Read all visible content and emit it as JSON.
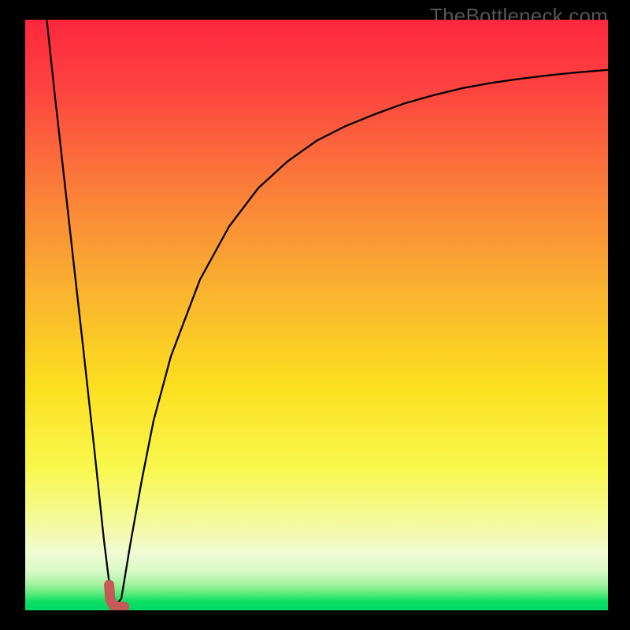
{
  "source_watermark": "TheBottleneck.com",
  "chart_data": {
    "type": "line",
    "title": "",
    "xlabel": "",
    "ylabel": "",
    "xlim": [
      0,
      100
    ],
    "ylim": [
      0,
      100
    ],
    "grid": false,
    "legend": false,
    "series": [
      {
        "name": "bottleneck-curve",
        "color": "#000000",
        "stroke_width": 2.3,
        "x": [
          3.7,
          5,
          7.5,
          10,
          12,
          13.5,
          14.5,
          15.3,
          16.5,
          18,
          20,
          22,
          25,
          30,
          35,
          40,
          45,
          50,
          55,
          60,
          65,
          70,
          75,
          80,
          85,
          90,
          95,
          100
        ],
        "values": [
          100,
          88,
          66,
          44,
          26,
          12,
          4,
          0.5,
          2,
          11,
          22,
          32,
          43,
          56,
          65,
          71.5,
          76,
          79.5,
          82,
          84,
          85.8,
          87.2,
          88.4,
          89.3,
          90,
          90.6,
          91.1,
          91.5
        ]
      },
      {
        "name": "highlight-marker",
        "color": "#c65a57",
        "stroke_width": 13,
        "linecap": "round",
        "x": [
          14.4,
          14.6,
          15.3,
          16.2,
          17.0
        ],
        "values": [
          4.3,
          1.8,
          0.6,
          0.6,
          0.6
        ]
      }
    ],
    "background_gradient": {
      "stops": [
        {
          "offset": 0.0,
          "color": "#fd273e"
        },
        {
          "offset": 0.12,
          "color": "#fd4440"
        },
        {
          "offset": 0.28,
          "color": "#fb7c3a"
        },
        {
          "offset": 0.45,
          "color": "#fab030"
        },
        {
          "offset": 0.62,
          "color": "#fcdf1f"
        },
        {
          "offset": 0.76,
          "color": "#f8f84e"
        },
        {
          "offset": 0.85,
          "color": "#f4fa9c"
        },
        {
          "offset": 0.905,
          "color": "#f0fbd4"
        },
        {
          "offset": 0.935,
          "color": "#d7f9c4"
        },
        {
          "offset": 0.958,
          "color": "#9ef29d"
        },
        {
          "offset": 0.974,
          "color": "#4ee877"
        },
        {
          "offset": 0.985,
          "color": "#0fdf64"
        },
        {
          "offset": 1.0,
          "color": "#00d968"
        }
      ]
    }
  }
}
